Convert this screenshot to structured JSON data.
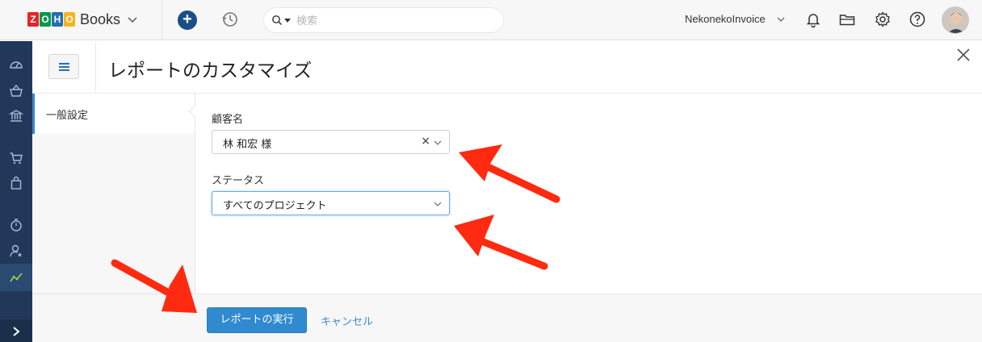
{
  "topbar": {
    "logo_text": "Books",
    "logo_letters": [
      "Z",
      "O",
      "H",
      "O"
    ],
    "logo_colors": [
      "#e42527",
      "#089949",
      "#226db4",
      "#f9b21d"
    ],
    "search_placeholder": "検索",
    "org_name": "NekonekoInvoice",
    "icons": [
      "plus-icon",
      "history-icon",
      "search-icon",
      "bell-icon",
      "folder-icon",
      "gear-icon",
      "help-icon",
      "avatar"
    ],
    "accent_color": "#1a4e86"
  },
  "sidebar": {
    "background": "#21385a",
    "items": [
      {
        "icon": "dashboard-icon"
      },
      {
        "icon": "basket-icon"
      },
      {
        "icon": "bank-icon"
      },
      {
        "icon": "cart-icon"
      },
      {
        "icon": "shopping-bag-icon"
      },
      {
        "icon": "timer-icon"
      },
      {
        "icon": "user-star-icon"
      },
      {
        "icon": "reports-icon",
        "active": true
      }
    ],
    "expand_icon": "chevron-right-icon"
  },
  "header": {
    "title": "レポートのカスタマイズ"
  },
  "left_nav": {
    "items": [
      {
        "label": "一般設定",
        "active": true
      }
    ]
  },
  "form": {
    "customer": {
      "label": "顧客名",
      "value": "林 和宏 様"
    },
    "status": {
      "label": "ステータス",
      "value": "すべてのプロジェクト"
    }
  },
  "footer": {
    "run_label": "レポートの実行",
    "cancel_label": "キャンセル",
    "button_color": "#2f8ad0"
  },
  "annotations": {
    "arrow_color": "#ff2a10",
    "arrows": [
      "arrow-to-customer-field",
      "arrow-to-status-field",
      "arrow-to-run-button"
    ]
  }
}
